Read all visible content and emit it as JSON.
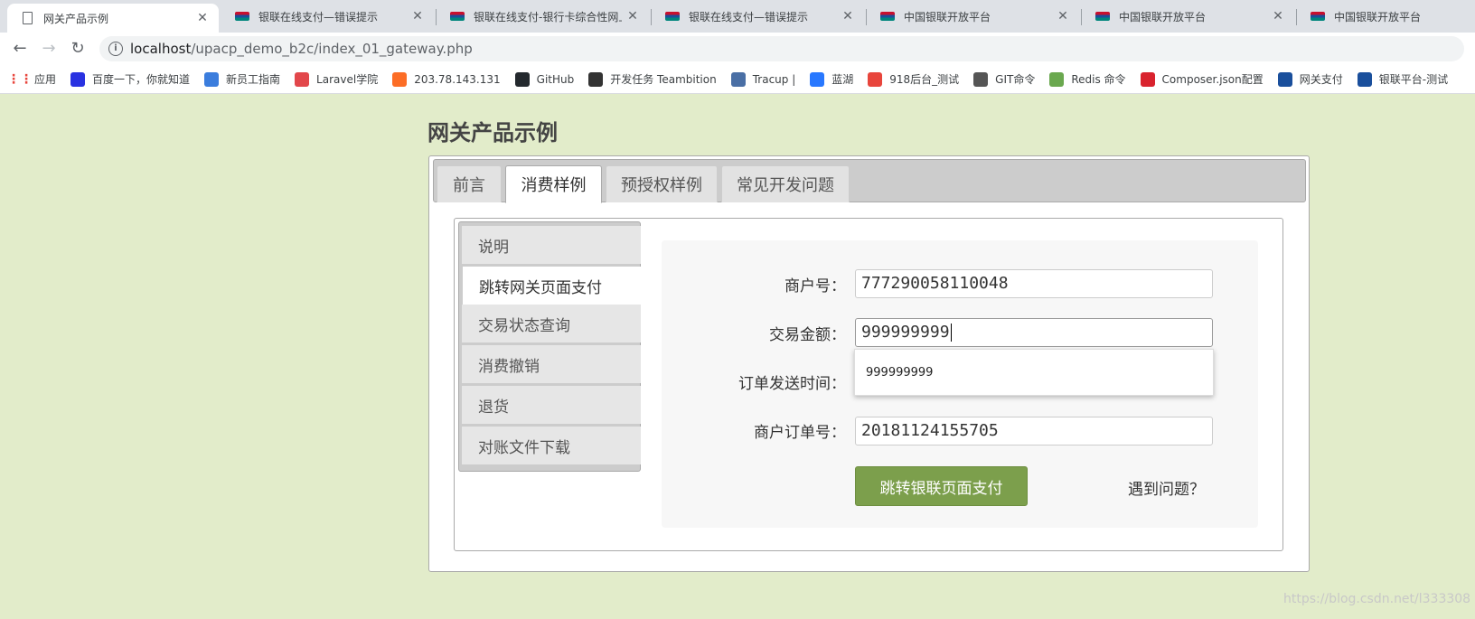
{
  "browser": {
    "tabs": [
      {
        "title": "网关产品示例",
        "icon": "document-icon",
        "active": true
      },
      {
        "title": "银联在线支付—错误提示",
        "icon": "unionpay-icon"
      },
      {
        "title": "银联在线支付-银行卡综合性网上",
        "icon": "unionpay-icon"
      },
      {
        "title": "银联在线支付—错误提示",
        "icon": "unionpay-icon"
      },
      {
        "title": "中国银联开放平台",
        "icon": "unionpay-icon"
      },
      {
        "title": "中国银联开放平台",
        "icon": "unionpay-icon"
      },
      {
        "title": "中国银联开放平台",
        "icon": "unionpay-icon"
      }
    ],
    "url": {
      "host": "localhost",
      "path": "/upacp_demo_b2c/index_01_gateway.php"
    },
    "bookmarks": [
      {
        "label": "应用",
        "icon": "apps-grid-icon",
        "color": "#e8453c"
      },
      {
        "label": "百度一下，你就知道",
        "icon": "baidu-paw-icon",
        "color": "#2932e1"
      },
      {
        "label": "新员工指南",
        "icon": "note-icon",
        "color": "#3b7ddd"
      },
      {
        "label": "Laravel学院",
        "icon": "laravel-icon",
        "color": "#e2474b"
      },
      {
        "label": "203.78.143.131",
        "icon": "gitlab-icon",
        "color": "#fc6d26"
      },
      {
        "label": "GitHub",
        "icon": "github-icon",
        "color": "#24292e"
      },
      {
        "label": "开发任务 Teambition",
        "icon": "teambition-icon",
        "color": "#333333"
      },
      {
        "label": "Tracup |",
        "icon": "tracup-icon",
        "color": "#4a6fa5"
      },
      {
        "label": "蓝湖",
        "icon": "lanhu-icon",
        "color": "#2878ff"
      },
      {
        "label": "918后台_测试",
        "icon": "918-icon",
        "color": "#e8453c"
      },
      {
        "label": "GIT命令",
        "icon": "git-icon",
        "color": "#555555"
      },
      {
        "label": "Redis 命令",
        "icon": "redis-icon",
        "color": "#6aa84f"
      },
      {
        "label": "Composer.json配置",
        "icon": "composer-icon",
        "color": "#d9232e"
      },
      {
        "label": "网关支付",
        "icon": "unionpay-icon",
        "color": "#1a4f9c"
      },
      {
        "label": "银联平台-测试",
        "icon": "unionpay-icon",
        "color": "#1a4f9c"
      }
    ]
  },
  "page": {
    "title": "网关产品示例",
    "main_tabs": [
      "前言",
      "消费样例",
      "预授权样例",
      "常见开发问题"
    ],
    "active_main_tab": 1,
    "side_tabs": [
      "说明",
      "跳转网关页面支付",
      "交易状态查询",
      "消费撤销",
      "退货",
      "对账文件下载"
    ],
    "active_side_tab": 1,
    "form": {
      "merchant_id_label": "商户号：",
      "merchant_id_value": "777290058110048",
      "amount_label": "交易金额：",
      "amount_value": "999999999",
      "order_time_label": "订单发送时间：",
      "order_id_label": "商户订单号：",
      "order_id_value": "20181124155705",
      "autocomplete_suggestion": "999999999",
      "submit_label": "跳转银联页面支付",
      "help_link": "遇到问题？"
    }
  },
  "watermark": "https://blog.csdn.net/l333308"
}
